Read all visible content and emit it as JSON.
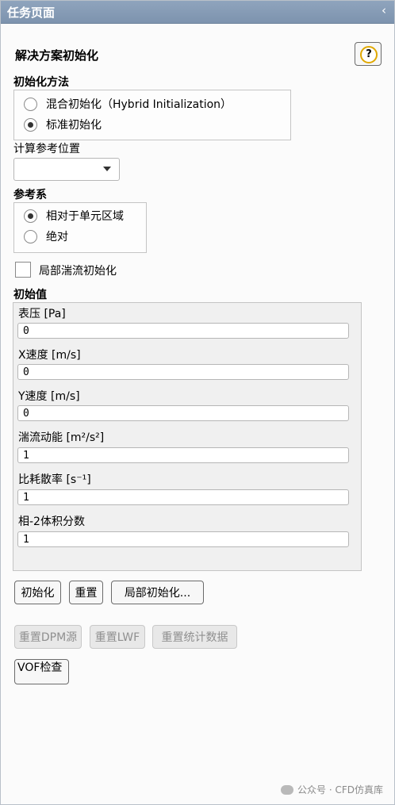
{
  "window": {
    "title": "任务页面",
    "collapse_icon": "chevron-left-icon",
    "collapse_glyph": "‹"
  },
  "panel": {
    "title": "解决方案初始化",
    "help_glyph": "?"
  },
  "init_method": {
    "label": "初始化方法",
    "options": [
      {
        "label": "混合初始化（Hybrid Initialization）",
        "selected": false
      },
      {
        "label": "标准初始化",
        "selected": true
      }
    ]
  },
  "compute_from": {
    "label": "计算参考位置",
    "value": ""
  },
  "reference_frame": {
    "label": "参考系",
    "options": [
      {
        "label": "相对于单元区域",
        "selected": true
      },
      {
        "label": "绝对",
        "selected": false
      }
    ]
  },
  "patch_turbulence": {
    "label": "局部湍流初始化",
    "checked": false
  },
  "initial_values": {
    "label": "初始值",
    "fields": [
      {
        "label": "表压 [Pa]",
        "value": "0"
      },
      {
        "label": "X速度 [m/s]",
        "value": "0"
      },
      {
        "label": "Y速度 [m/s]",
        "value": "0"
      },
      {
        "label": "湍流动能 [m²/s²]",
        "value": "1"
      },
      {
        "label": "比耗散率 [s⁻¹]",
        "value": "1"
      },
      {
        "label": "相-2体积分数",
        "value": "1"
      }
    ]
  },
  "buttons": {
    "initialize": "初始化",
    "reset": "重置",
    "patch": "局部初始化...",
    "reset_dpm": "重置DPM源",
    "reset_lwf": "重置LWF",
    "reset_stats": "重置统计数据",
    "vof_check": "VOF检查"
  },
  "watermark": "公众号 · CFD仿真库"
}
